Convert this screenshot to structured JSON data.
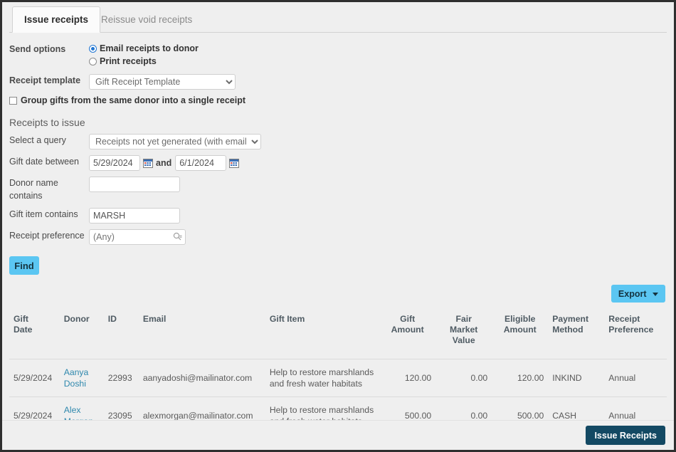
{
  "tabs": [
    {
      "label": "Issue receipts",
      "active": true
    },
    {
      "label": "Reissue void receipts",
      "active": false
    }
  ],
  "form": {
    "send_options_label": "Send options",
    "send_options": [
      {
        "label": "Email receipts to donor",
        "selected": true
      },
      {
        "label": "Print receipts",
        "selected": false
      }
    ],
    "receipt_template_label": "Receipt template",
    "receipt_template_value": "Gift Receipt Template",
    "group_gifts_label": "Group gifts from the same donor into a single receipt",
    "group_gifts_checked": false
  },
  "receipts_section": {
    "title": "Receipts to issue",
    "select_query_label": "Select a query",
    "select_query_value": "Receipts not yet generated (with email)",
    "gift_date_label": "Gift date between",
    "gift_date_from": "5/29/2024",
    "gift_date_and": "and",
    "gift_date_to": "6/1/2024",
    "donor_name_label": "Donor name contains",
    "donor_name_value": "",
    "gift_item_label": "Gift item contains",
    "gift_item_value": "MARSH",
    "receipt_pref_label": "Receipt preference",
    "receipt_pref_placeholder": "(Any)",
    "find_label": "Find"
  },
  "toolbar": {
    "export_label": "Export"
  },
  "table": {
    "columns": [
      "Gift\nDate",
      "Donor",
      "ID",
      "Email",
      "Gift Item",
      "Gift\nAmount",
      "Fair\nMarket\nValue",
      "Eligible\nAmount",
      "Payment\nMethod",
      "Receipt\nPreference"
    ],
    "rows": [
      {
        "gift_date": "5/29/2024",
        "donor": "Aanya Doshi",
        "id": "22993",
        "email": "aanyadoshi@mailinator.com",
        "gift_item": "Help to restore marshlands and fresh water habitats",
        "gift_amount": "120.00",
        "fair_market_value": "0.00",
        "eligible_amount": "120.00",
        "payment_method": "INKIND",
        "receipt_preference": "Annual"
      },
      {
        "gift_date": "5/29/2024",
        "donor": "Alex Morgan",
        "id": "23095",
        "email": "alexmorgan@mailinator.com",
        "gift_item": "Help to restore marshlands and fresh water habitats",
        "gift_amount": "500.00",
        "fair_market_value": "0.00",
        "eligible_amount": "500.00",
        "payment_method": "CASH",
        "receipt_preference": "Annual"
      }
    ]
  },
  "footer": {
    "issue_receipts_label": "Issue Receipts"
  },
  "colors": {
    "accent_blue": "#5bc6f2",
    "dark_navy": "#134963",
    "link_blue": "#2f88ad",
    "page_bg": "#efefef"
  }
}
